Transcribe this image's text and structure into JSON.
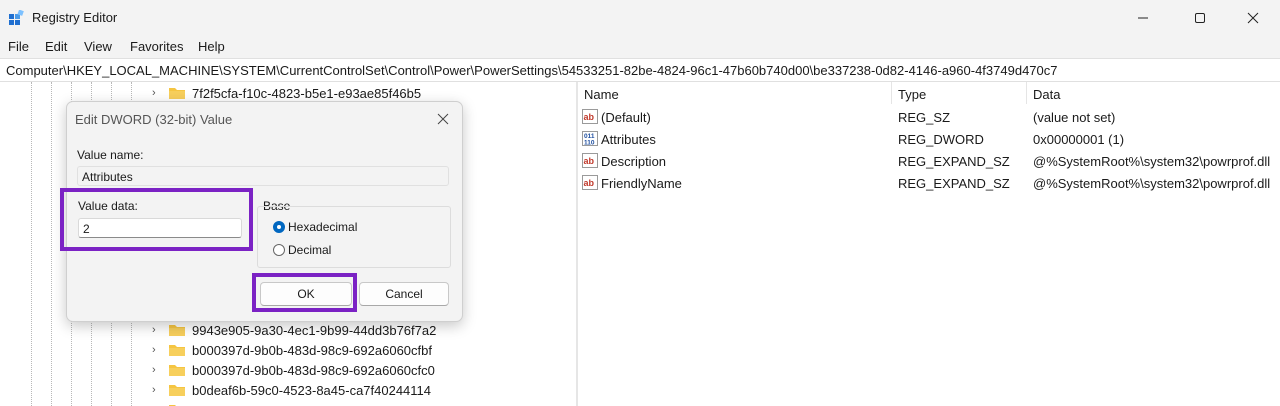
{
  "window": {
    "title": "Registry Editor"
  },
  "menu": [
    "File",
    "Edit",
    "View",
    "Favorites",
    "Help"
  ],
  "address": "Computer\\HKEY_LOCAL_MACHINE\\SYSTEM\\CurrentControlSet\\Control\\Power\\PowerSettings\\54533251-82be-4824-96c1-47b60b740d00\\be337238-0d82-4146-a960-4f3749d470c7",
  "tree": {
    "items": [
      "7f2f5cfa-f10c-4823-b5e1-e93ae85f46b5",
      "9943e905-9a30-4ec1-9b99-44dd3b76f7a2",
      "b000397d-9b0b-483d-98c9-692a6060cfbf",
      "b000397d-9b0b-483d-98c9-692a6060cfc0",
      "b0deaf6b-59c0-4523-8a45-ca7f40244114"
    ]
  },
  "columns": {
    "name": "Name",
    "type": "Type",
    "data": "Data"
  },
  "values": [
    {
      "icon": "string-value-icon",
      "name": "(Default)",
      "type": "REG_SZ",
      "data": "(value not set)"
    },
    {
      "icon": "binary-value-icon",
      "name": "Attributes",
      "type": "REG_DWORD",
      "data": "0x00000001 (1)"
    },
    {
      "icon": "string-value-icon",
      "name": "Description",
      "type": "REG_EXPAND_SZ",
      "data": "@%SystemRoot%\\system32\\powrprof.dll"
    },
    {
      "icon": "string-value-icon",
      "name": "FriendlyName",
      "type": "REG_EXPAND_SZ",
      "data": "@%SystemRoot%\\system32\\powrprof.dll"
    }
  ],
  "dialog": {
    "title": "Edit DWORD (32-bit) Value",
    "value_name_label": "Value name:",
    "value_name": "Attributes",
    "value_data_label": "Value data:",
    "value_data": "2",
    "base_label": "Base",
    "radio_hex": "Hexadecimal",
    "radio_dec": "Decimal",
    "selected_base": "Hexadecimal",
    "ok": "OK",
    "cancel": "Cancel"
  },
  "colors": {
    "highlight": "#7b22c4",
    "accent": "#0067c0",
    "folder": "#f5c542"
  }
}
